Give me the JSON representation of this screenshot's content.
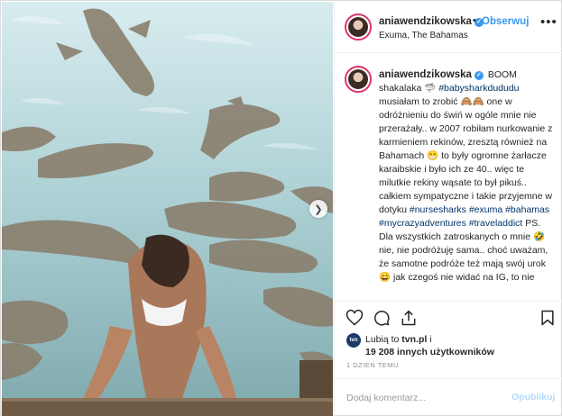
{
  "post": {
    "username": "aniawendzikowska",
    "follow_label": "Obserwuj",
    "separator": "•",
    "location": "Exuma, The Bahamas",
    "more_label": "•••"
  },
  "caption": {
    "username": "aniawendzikowska",
    "segments": [
      {
        "t": "BOOM shakalaka 🦈 ",
        "h": false
      },
      {
        "t": "#babysharkdududu",
        "h": true
      },
      {
        "t": " musiałam to zrobić 🙈🙈 one w odróżnieniu do świń w ogóle mnie nie przerażały.. w 2007 robiłam nurkowanie z karmieniem rekinów, zresztą również na Bahamach 😁 to były ogromne żarłacze karaibskie i było ich ze 40.. więc te milutkie rekiny wąsate to był pikuś.. całkiem sympatyczne i takie przyjemne w dotyku ",
        "h": false
      },
      {
        "t": "#nursesharks",
        "h": true
      },
      {
        "t": " ",
        "h": false
      },
      {
        "t": "#exuma",
        "h": true
      },
      {
        "t": " ",
        "h": false
      },
      {
        "t": "#bahamas",
        "h": true
      },
      {
        "t": " ",
        "h": false
      },
      {
        "t": "#mycrazyadventures",
        "h": true
      },
      {
        "t": " ",
        "h": false
      },
      {
        "t": "#traveladdict",
        "h": true
      },
      {
        "t": " PS. Dla wszystkich zatroskanych o mnie 🤣 nie, nie podróżuję sama.. choć uważam, że samotne podróże też mają swój urok 😄 jak czegoś nie widać na IG, to nie",
        "h": false
      }
    ]
  },
  "likes": {
    "prefix": "Lubią to",
    "first_liker": "tvn.pl",
    "and": "i",
    "others": "19 208 innych użytkowników",
    "logo_text": "tvn"
  },
  "time": "1 DZIEŃ TEMU",
  "comment": {
    "placeholder": "Dodaj komentarz...",
    "publish_label": "Opublikuj"
  },
  "colors": {
    "accent": "#3897f0",
    "hashtag": "#003569",
    "border": "#efefef",
    "publish_disabled": "#b3dbff"
  },
  "icons": [
    "heart-icon",
    "comment-icon",
    "share-icon",
    "bookmark-icon",
    "verified-icon",
    "chevron-right-icon",
    "more-icon"
  ]
}
